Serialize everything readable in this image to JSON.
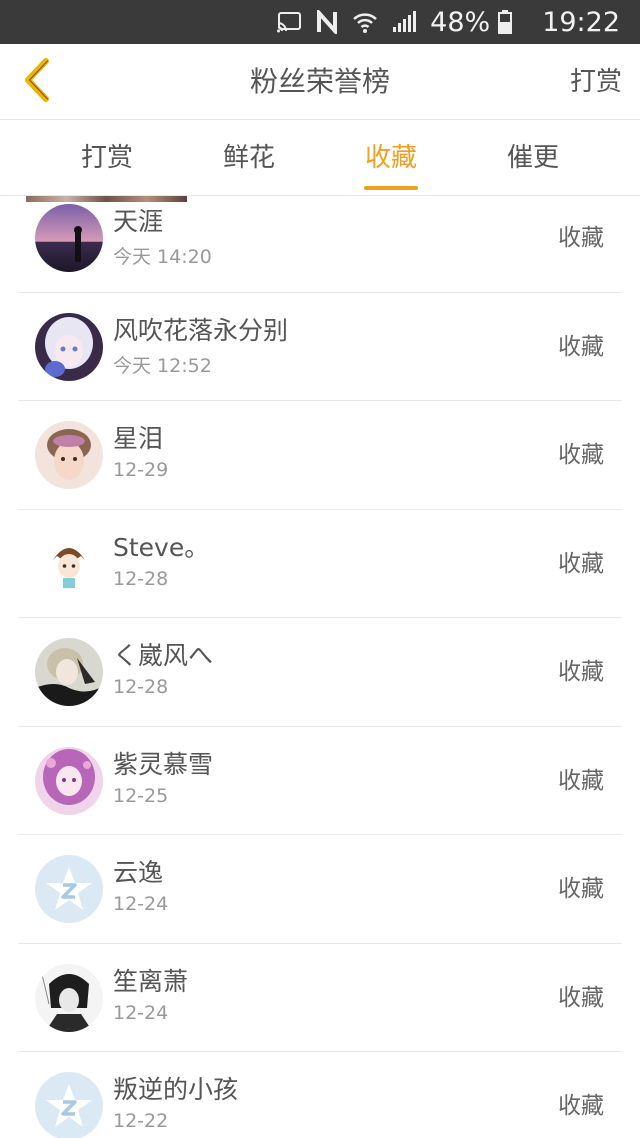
{
  "status_bar": {
    "icons": [
      "cast-icon",
      "nfc-icon",
      "wifi-icon",
      "signal-icon"
    ],
    "battery_percent": "48%",
    "time": "19:22"
  },
  "header": {
    "back_icon": "chevron-left-icon",
    "title": "粉丝荣誉榜",
    "action": "打赏"
  },
  "tabs": [
    {
      "label": "打赏",
      "active": false
    },
    {
      "label": "鲜花",
      "active": false
    },
    {
      "label": "收藏",
      "active": true
    },
    {
      "label": "催更",
      "active": false
    }
  ],
  "accent_color": "#f0a020",
  "list": [
    {
      "name": "天涯",
      "time": "今天 14:20",
      "action": "收藏",
      "avatar": "sunset-silhouette"
    },
    {
      "name": "风吹花落永分别",
      "time": "今天 12:52",
      "action": "收藏",
      "avatar": "anime-white-hair"
    },
    {
      "name": "星泪",
      "time": "12-29",
      "action": "收藏",
      "avatar": "portrait-boy"
    },
    {
      "name": "Steve。",
      "time": "12-28",
      "action": "收藏",
      "avatar": "chibi-drawing"
    },
    {
      "name": "く崴风へ",
      "time": "12-28",
      "action": "收藏",
      "avatar": "anime-dark"
    },
    {
      "name": "紫灵慕雪",
      "time": "12-25",
      "action": "收藏",
      "avatar": "anime-purple"
    },
    {
      "name": "云逸",
      "time": "12-24",
      "action": "收藏",
      "avatar": "default-qzone"
    },
    {
      "name": "笙离萧",
      "time": "12-24",
      "action": "收藏",
      "avatar": "sketch-bw"
    },
    {
      "name": "叛逆的小孩",
      "time": "12-22",
      "action": "收藏",
      "avatar": "default-qzone"
    }
  ]
}
